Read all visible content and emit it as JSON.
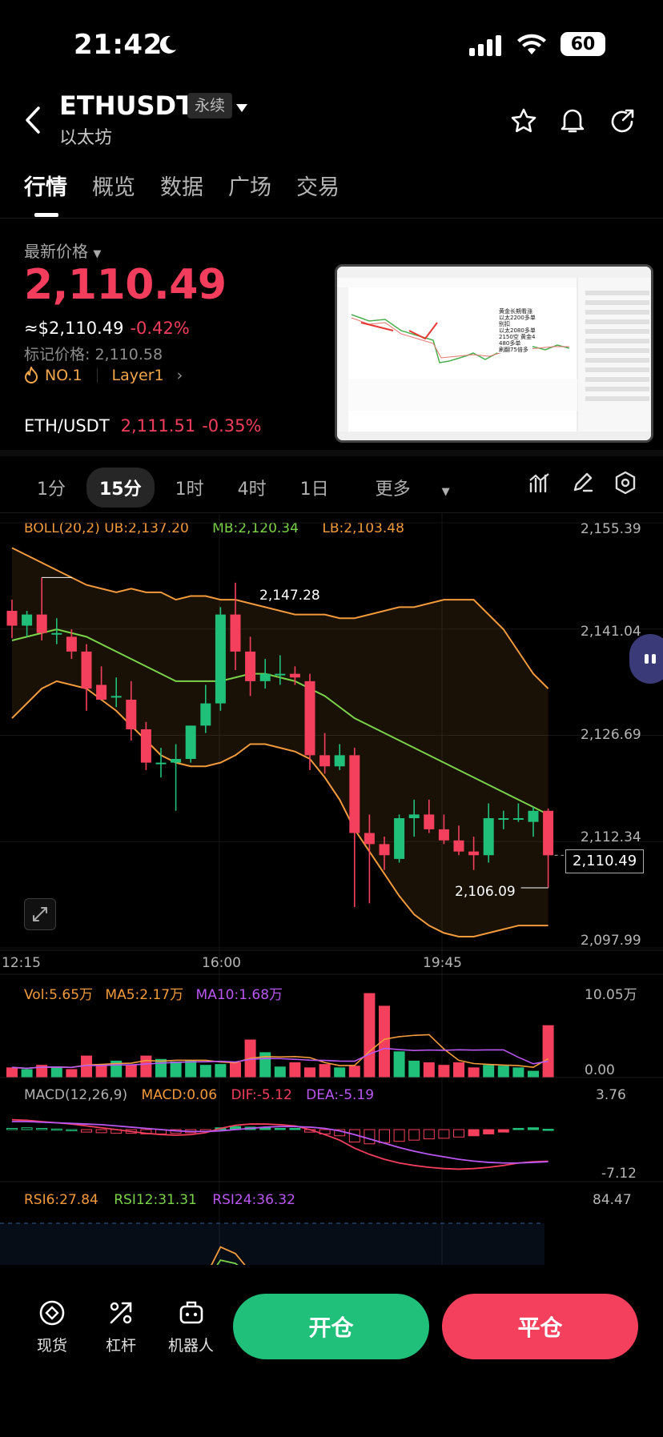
{
  "status_bar": {
    "time": "21:42",
    "battery": "60"
  },
  "header": {
    "symbol": "ETHUSDT",
    "contract_type": "永续",
    "name": "以太坊"
  },
  "tabs": [
    "行情",
    "概览",
    "数据",
    "广场",
    "交易"
  ],
  "price": {
    "latest_label": "最新价格",
    "last": "2,110.49",
    "usd": "≈$2,110.49",
    "change": "-0.42%",
    "mark": "标记价格: 2,110.58",
    "rank": "NO.1",
    "tag": "Layer1",
    "pair": "ETH/USDT",
    "pair_price": "2,111.51",
    "pair_change": "-0.35%"
  },
  "thumbnail": {
    "notes": [
      "黄金长期看涨",
      "以太2200多单",
      "别扣",
      "以太2080多单",
      "2150空 黄金4",
      "480多单",
      "刷翻75倍多"
    ]
  },
  "intervals": [
    "1分",
    "15分",
    "1时",
    "4时",
    "1日",
    "更多"
  ],
  "main_chart": {
    "boll": "BOLL(20,2)",
    "ub": "UB:2,137.20",
    "mb": "MB:2,120.34",
    "lb": "LB:2,103.48",
    "y_ticks": [
      "2,155.39",
      "2,141.04",
      "2,126.69",
      "2,112.34",
      "2,097.99"
    ],
    "x_ticks": [
      "12:15",
      "16:00",
      "19:45"
    ],
    "high_label": "2,147.28",
    "low_label": "2,106.09",
    "current": "2,110.49"
  },
  "volume": {
    "vol": "Vol:5.65万",
    "ma5": "MA5:2.17万",
    "ma10": "MA10:1.68万",
    "top": "10.05万",
    "bottom": "0.00"
  },
  "macd": {
    "label": "MACD(12,26,9)",
    "macd": "MACD:0.06",
    "dif": "DIF:-5.12",
    "dea": "DEA:-5.19",
    "top": "3.76",
    "bottom": "-7.12"
  },
  "rsi": {
    "rsi6": "RSI6:27.84",
    "rsi12": "RSI12:31.31",
    "rsi24": "RSI24:36.32",
    "top": "84.47"
  },
  "bottom_bar": {
    "spot": "现货",
    "leverage": "杠杆",
    "bot": "机器人",
    "open": "开仓",
    "close": "平仓"
  },
  "colors": {
    "up": "#21c07a",
    "down": "#f5405d",
    "boll_band": "#f39a3c",
    "mb": "#7bd34a"
  },
  "chart_data": {
    "type": "candlestick",
    "ylim": [
      2097.99,
      2155.39
    ],
    "candles": [
      {
        "o": 2143.5,
        "h": 2145.0,
        "l": 2139.8,
        "c": 2141.5
      },
      {
        "o": 2141.5,
        "h": 2143.5,
        "l": 2140.0,
        "c": 2143.0
      },
      {
        "o": 2143.0,
        "h": 2148.0,
        "l": 2139.5,
        "c": 2140.5
      },
      {
        "o": 2140.5,
        "h": 2142.5,
        "l": 2139.0,
        "c": 2140.5
      },
      {
        "o": 2140.0,
        "h": 2141.0,
        "l": 2137.0,
        "c": 2138.0
      },
      {
        "o": 2138.0,
        "h": 2139.0,
        "l": 2130.0,
        "c": 2133.0
      },
      {
        "o": 2133.5,
        "h": 2136.0,
        "l": 2131.5,
        "c": 2131.5
      },
      {
        "o": 2132.0,
        "h": 2134.5,
        "l": 2130.5,
        "c": 2132.0
      },
      {
        "o": 2131.5,
        "h": 2134.0,
        "l": 2126.0,
        "c": 2127.5
      },
      {
        "o": 2127.5,
        "h": 2128.5,
        "l": 2122.0,
        "c": 2123.0
      },
      {
        "o": 2123.0,
        "h": 2125.0,
        "l": 2121.0,
        "c": 2123.0
      },
      {
        "o": 2123.0,
        "h": 2125.5,
        "l": 2116.5,
        "c": 2123.5
      },
      {
        "o": 2123.5,
        "h": 2128.0,
        "l": 2123.0,
        "c": 2128.0
      },
      {
        "o": 2128.0,
        "h": 2133.5,
        "l": 2127.0,
        "c": 2131.0
      },
      {
        "o": 2131.0,
        "h": 2144.0,
        "l": 2130.0,
        "c": 2143.0
      },
      {
        "o": 2143.0,
        "h": 2147.3,
        "l": 2135.5,
        "c": 2138.0
      },
      {
        "o": 2138.0,
        "h": 2140.0,
        "l": 2132.0,
        "c": 2134.0
      },
      {
        "o": 2134.0,
        "h": 2137.0,
        "l": 2133.0,
        "c": 2135.0
      },
      {
        "o": 2135.0,
        "h": 2137.5,
        "l": 2133.5,
        "c": 2135.0
      },
      {
        "o": 2135.0,
        "h": 2136.0,
        "l": 2133.5,
        "c": 2134.5
      },
      {
        "o": 2134.0,
        "h": 2135.0,
        "l": 2122.0,
        "c": 2124.0
      },
      {
        "o": 2124.0,
        "h": 2127.0,
        "l": 2121.5,
        "c": 2122.5
      },
      {
        "o": 2122.5,
        "h": 2125.5,
        "l": 2122.0,
        "c": 2124.0
      },
      {
        "o": 2124.0,
        "h": 2125.0,
        "l": 2103.5,
        "c": 2113.5
      },
      {
        "o": 2113.5,
        "h": 2116.0,
        "l": 2104.0,
        "c": 2112.0
      },
      {
        "o": 2112.0,
        "h": 2113.0,
        "l": 2108.5,
        "c": 2110.5
      },
      {
        "o": 2110.0,
        "h": 2116.0,
        "l": 2109.5,
        "c": 2115.5
      },
      {
        "o": 2115.5,
        "h": 2118.0,
        "l": 2113.0,
        "c": 2116.0
      },
      {
        "o": 2116.0,
        "h": 2118.0,
        "l": 2113.5,
        "c": 2114.0
      },
      {
        "o": 2114.0,
        "h": 2116.0,
        "l": 2112.0,
        "c": 2112.5
      },
      {
        "o": 2112.5,
        "h": 2114.5,
        "l": 2110.5,
        "c": 2111.0
      },
      {
        "o": 2111.0,
        "h": 2113.0,
        "l": 2108.5,
        "c": 2110.5
      },
      {
        "o": 2110.5,
        "h": 2117.5,
        "l": 2109.5,
        "c": 2115.5
      },
      {
        "o": 2115.5,
        "h": 2116.5,
        "l": 2114.0,
        "c": 2115.5
      },
      {
        "o": 2115.5,
        "h": 2117.5,
        "l": 2115.0,
        "c": 2115.5
      },
      {
        "o": 2115.0,
        "h": 2117.0,
        "l": 2113.0,
        "c": 2116.5
      },
      {
        "o": 2116.5,
        "h": 2116.8,
        "l": 2106.1,
        "c": 2110.49
      }
    ],
    "ub": [
      2152,
      2151,
      2150,
      2149,
      2148,
      2147,
      2146.5,
      2146,
      2146.5,
      2146,
      2146,
      2145,
      2145.5,
      2145.5,
      2145,
      2145,
      2144.5,
      2144,
      2143.5,
      2143,
      2143,
      2143,
      2142.5,
      2142.5,
      2143,
      2143.5,
      2144,
      2144,
      2144.5,
      2145,
      2145,
      2145,
      2143,
      2141,
      2138,
      2135,
      2133
    ],
    "mb": [
      2139.5,
      2140,
      2140.5,
      2141,
      2140.5,
      2140,
      2139,
      2138,
      2137,
      2136,
      2135,
      2134,
      2134,
      2134,
      2134,
      2134.5,
      2135,
      2135,
      2134.5,
      2134,
      2133,
      2132,
      2130.5,
      2129,
      2128,
      2127,
      2126,
      2125,
      2124,
      2123,
      2122,
      2121,
      2120,
      2119,
      2118,
      2117,
      2116
    ],
    "lb": [
      2129,
      2131,
      2133,
      2134,
      2133.5,
      2133,
      2131.5,
      2130,
      2128,
      2126,
      2124,
      2123,
      2122.5,
      2122.5,
      2123,
      2124,
      2125.5,
      2125.5,
      2125,
      2124.5,
      2123.5,
      2121,
      2118,
      2114,
      2111,
      2108,
      2105,
      2102.5,
      2101,
      2100,
      2099.5,
      2099.5,
      2100,
      2100.5,
      2101,
      2101,
      2101
    ],
    "volume": [
      1.2,
      1.0,
      1.5,
      1.3,
      1.0,
      2.6,
      1.4,
      2.0,
      1.5,
      2.6,
      2.2,
      1.9,
      2.0,
      1.5,
      1.6,
      1.8,
      4.5,
      3.0,
      1.3,
      1.8,
      1.2,
      1.6,
      1.2,
      1.4,
      10.0,
      8.5,
      3.1,
      2.0,
      1.8,
      1.5,
      1.8,
      1.2,
      1.5,
      1.4,
      1.2,
      0.8,
      6.2
    ],
    "macd_hist": [
      0.2,
      0.3,
      0.2,
      0.1,
      0,
      -0.4,
      -0.5,
      -0.6,
      -0.6,
      -0.7,
      -0.7,
      -0.6,
      -0.5,
      -0.3,
      0.3,
      0.5,
      0.4,
      0.3,
      0.2,
      0.2,
      -0.4,
      -0.7,
      -1.0,
      -2.0,
      -2.3,
      -2.1,
      -1.9,
      -1.7,
      -1.5,
      -1.4,
      -1.2,
      -1.0,
      -0.7,
      -0.4,
      0.2,
      0.3,
      0.06
    ],
    "macd_dif": [
      1.6,
      1.5,
      1.3,
      1.1,
      0.9,
      0.6,
      0.3,
      0,
      -0.3,
      -0.6,
      -0.8,
      -0.9,
      -0.8,
      -0.5,
      0.2,
      0.7,
      0.9,
      0.9,
      0.8,
      0.6,
      0,
      -0.8,
      -1.7,
      -3.0,
      -4.0,
      -4.8,
      -5.4,
      -5.8,
      -6.1,
      -6.3,
      -6.4,
      -6.3,
      -6.1,
      -5.8,
      -5.4,
      -5.2,
      -5.12
    ],
    "macd_dea": [
      1.3,
      1.3,
      1.2,
      1.1,
      1.0,
      0.9,
      0.8,
      0.6,
      0.4,
      0.2,
      0,
      -0.2,
      -0.3,
      -0.3,
      -0.2,
      0,
      0.2,
      0.4,
      0.5,
      0.5,
      0.4,
      0.2,
      -0.2,
      -0.8,
      -1.5,
      -2.2,
      -2.9,
      -3.5,
      -4.0,
      -4.4,
      -4.8,
      -5.1,
      -5.3,
      -5.4,
      -5.4,
      -5.3,
      -5.19
    ],
    "rsi6": [
      55,
      58,
      52,
      50,
      48,
      40,
      38,
      35,
      30,
      28,
      33,
      38,
      45,
      52,
      70,
      66,
      55,
      50,
      48,
      46,
      32,
      30,
      31,
      26,
      30,
      28,
      38,
      42,
      40,
      36,
      34,
      33,
      45,
      44,
      42,
      46,
      27.84
    ],
    "rsi12": [
      52,
      54,
      50,
      49,
      47,
      42,
      40,
      38,
      34,
      32,
      35,
      38,
      43,
      49,
      62,
      60,
      53,
      50,
      48,
      47,
      37,
      35,
      35,
      31,
      33,
      31,
      37,
      40,
      39,
      37,
      35,
      35,
      41,
      41,
      40,
      43,
      31.31
    ],
    "rsi24": [
      50,
      51,
      50,
      49,
      48,
      45,
      44,
      42,
      39,
      37,
      38,
      40,
      43,
      47,
      56,
      55,
      51,
      49,
      48,
      47,
      41,
      39,
      39,
      36,
      37,
      36,
      39,
      41,
      40,
      39,
      38,
      38,
      41,
      41,
      40,
      42,
      36.32
    ]
  }
}
